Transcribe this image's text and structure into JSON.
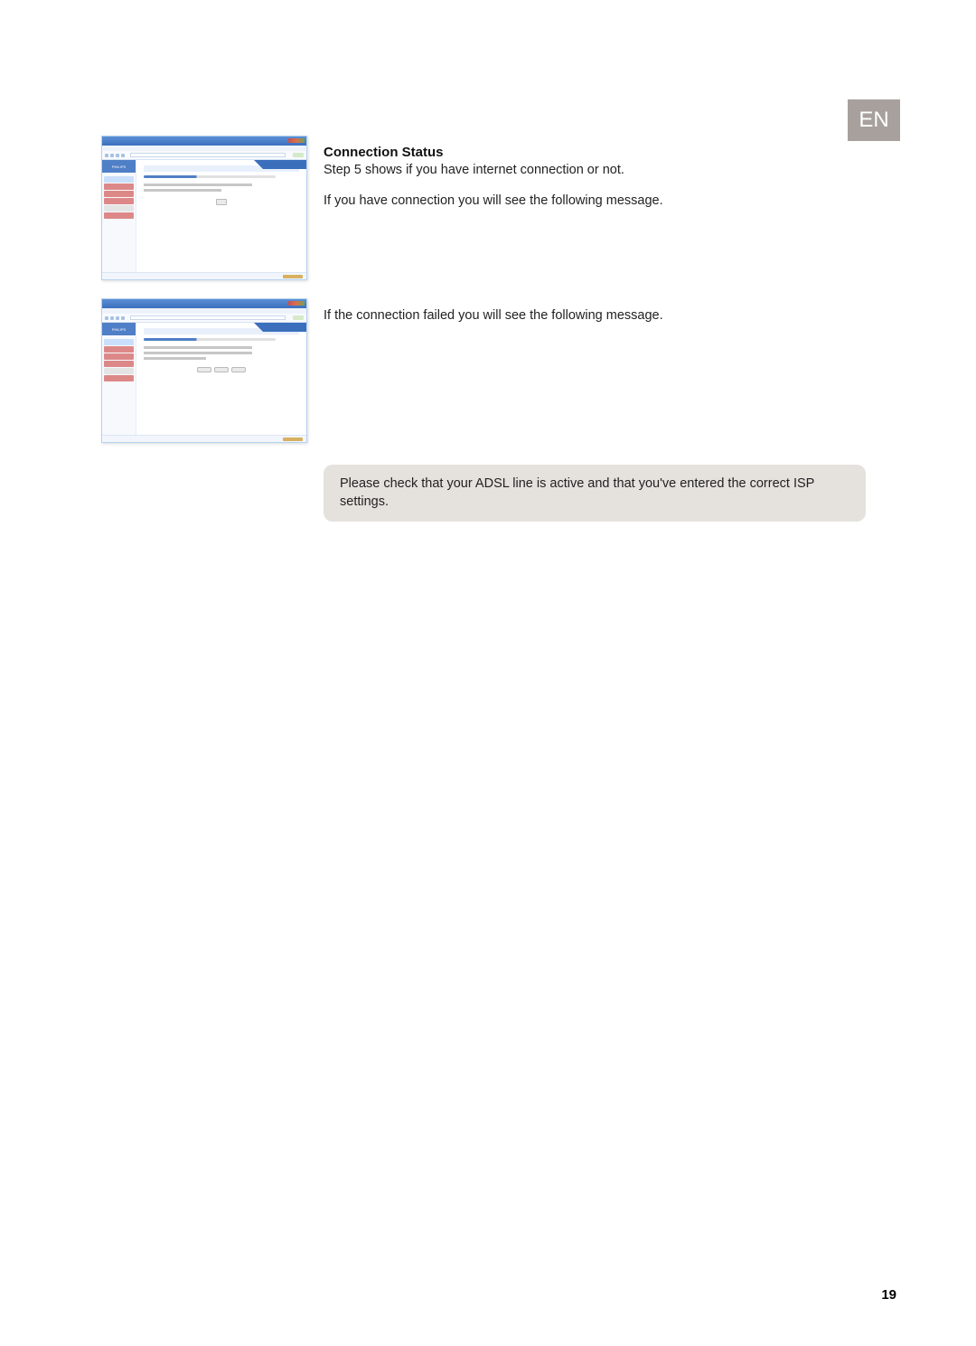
{
  "lang_badge": "EN",
  "section": {
    "title": "Connection Status",
    "para1": "Step 5 shows if you have internet connection or not.",
    "para2": "If you have connection you will see the following message.",
    "para3": "If the connection failed you will see the following message."
  },
  "note": "Please check that your ADSL line is active and that you've entered the correct ISP settings.",
  "page_number": "19",
  "screenshot_logo": "PHILIPS"
}
